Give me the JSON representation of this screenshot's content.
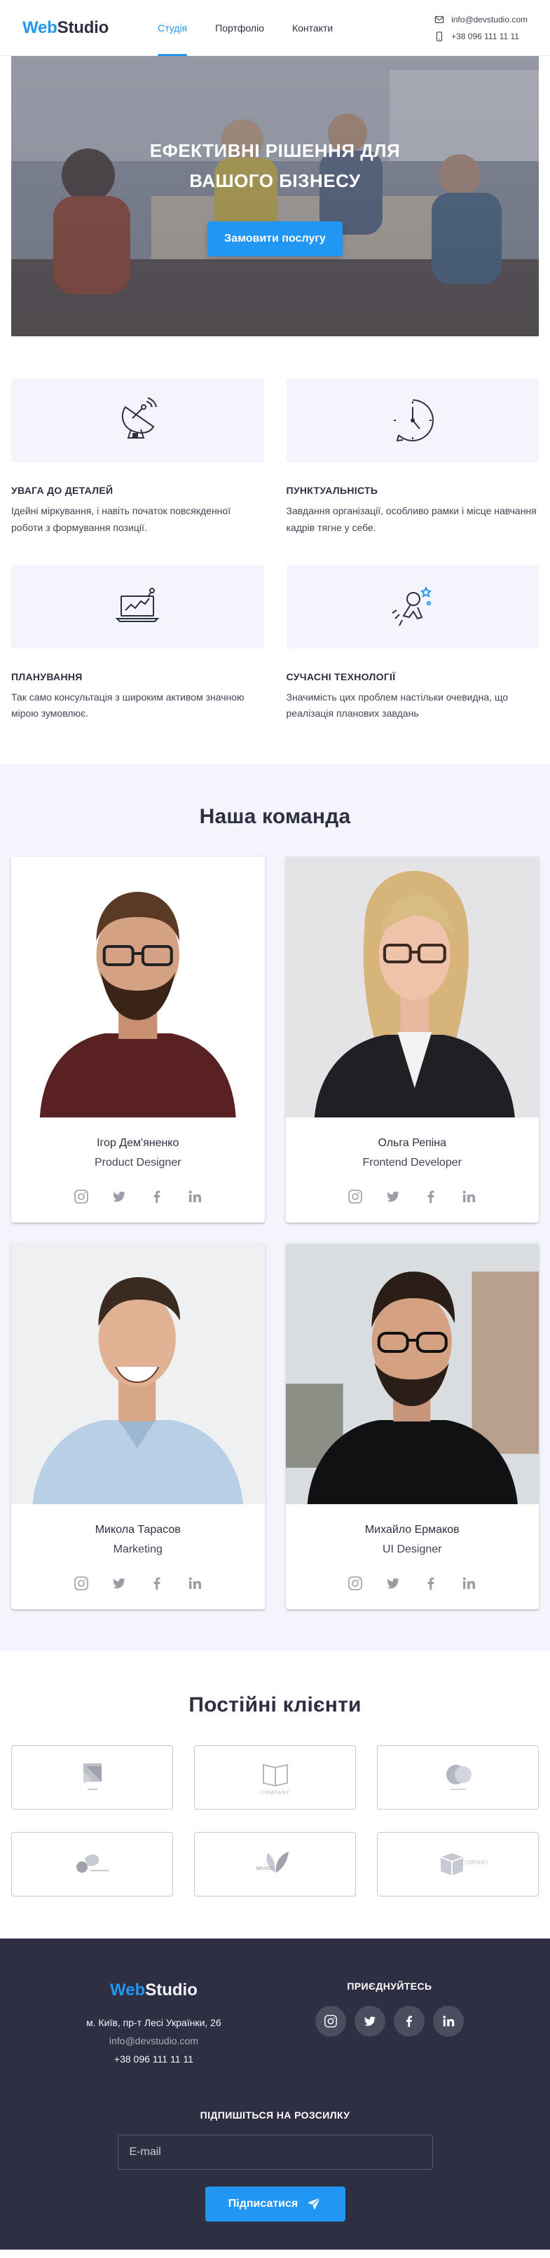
{
  "header": {
    "logo_part1": "Web",
    "logo_part2": "Studio",
    "nav": [
      {
        "label": "Студія",
        "active": true
      },
      {
        "label": "Портфоліо",
        "active": false
      },
      {
        "label": "Контакти",
        "active": false
      }
    ],
    "email": "info@devstudio.com",
    "phone": "+38 096 111 11 11"
  },
  "hero": {
    "title": "ЕФЕКТИВНІ РІШЕННЯ ДЛЯ ВАШОГО БІЗНЕСУ",
    "button": "Замовити послугу"
  },
  "features": [
    {
      "icon": "satellite-dish-icon",
      "title": "Увага до деталей",
      "text": "Ідейні міркування, і навіть початок повсякденної роботи з формування позиції."
    },
    {
      "icon": "clock-icon",
      "title": "Пунктуальність",
      "text": "Завдання організації, особливо рамки і місце навчання кадрів тягне у себе."
    },
    {
      "icon": "laptop-chart-icon",
      "title": "Планування",
      "text": "Так само консультація з широким активом значною мірою зумовлює."
    },
    {
      "icon": "astronaut-icon",
      "title": "Сучасні технології",
      "text": "Значимість цих проблем настільки очевидна, що реалізація планових завдань"
    }
  ],
  "team": {
    "title": "Наша команда",
    "members": [
      {
        "name": "Ігор Дем'яненко",
        "role": "Product Designer"
      },
      {
        "name": "Ольга Репіна",
        "role": "Frontend Developer"
      },
      {
        "name": "Микола Тарасов",
        "role": "Marketing"
      },
      {
        "name": "Михайло Ермаков",
        "role": "UI Designer"
      }
    ]
  },
  "clients": {
    "title": "Постійні клієнти",
    "logos": [
      "logo-1",
      "company-book-logo",
      "circles-logo",
      "sound-logo",
      "leaf-brand-logo",
      "company-box-logo"
    ],
    "captions": [
      "",
      "COMPANY",
      "",
      "",
      "BRAND",
      "COMPANY"
    ]
  },
  "footer": {
    "logo_part1": "Web",
    "logo_part2": "Studio",
    "address": "м. Київ, пр-т Лесі Українки, 26",
    "email": "info@devstudio.com",
    "phone": "+38 096 111 11 11",
    "join_heading": "Приєднуйтесь",
    "subscribe_heading": "Підпишіться на розсилку",
    "email_placeholder": "E-mail",
    "subscribe_button": "Підписатися"
  },
  "colors": {
    "accent": "#2196f3",
    "dark": "#2e2f42",
    "light_bg": "#f4f4fd"
  }
}
